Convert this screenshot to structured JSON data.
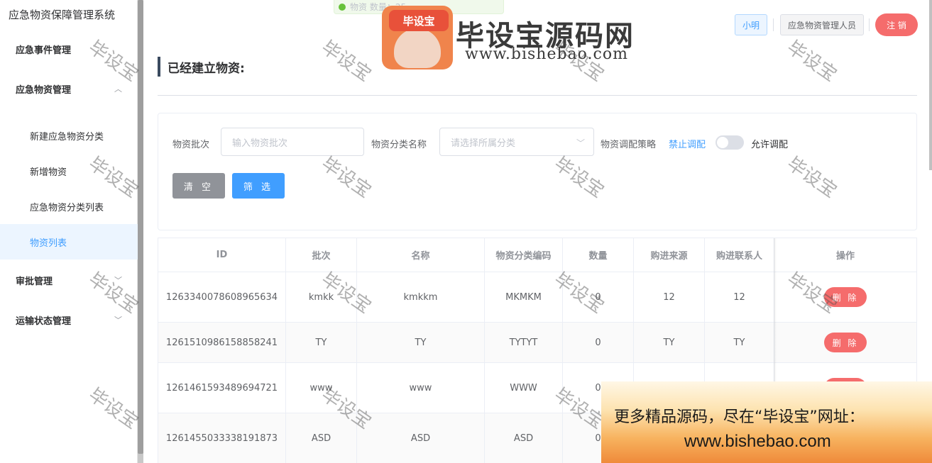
{
  "sidebar": {
    "app_title": "应急物资保障管理系统",
    "menu": [
      {
        "label": "应急事件管理"
      },
      {
        "label": "应急物资管理",
        "chevron": "^"
      },
      {
        "label": "审批管理",
        "chevron": "⌄"
      },
      {
        "label": "运输状态管理",
        "chevron": "⌄"
      }
    ],
    "submenu": [
      {
        "label": "新建应急物资分类"
      },
      {
        "label": "新增物资"
      },
      {
        "label": "应急物资分类列表"
      },
      {
        "label": "物资列表",
        "active": true
      }
    ]
  },
  "topbar": {
    "user": "小明",
    "role": "应急物资管理人员",
    "logout": "注 销",
    "toast": "物资 数量：25"
  },
  "page": {
    "title": "已经建立物资:"
  },
  "filter": {
    "batch_label": "物资批次",
    "batch_placeholder": "输入物资批次",
    "category_label": "物资分类名称",
    "category_placeholder": "请选择所属分类",
    "strategy_label": "物资调配策略",
    "switch_off_label": "禁止调配",
    "switch_on_label": "允许调配",
    "switch_value": false,
    "clear_button": "清 空",
    "filter_button": "筛 选"
  },
  "table": {
    "headers": [
      "ID",
      "批次",
      "名称",
      "物资分类编码",
      "数量",
      "购进来源",
      "购进联系人",
      "操作"
    ],
    "delete_label": "删 除",
    "rows": [
      [
        "1263340078608965634",
        "kmkk",
        "kmkkm",
        "MKMKM",
        "0",
        "12",
        "12"
      ],
      [
        "1261510986158858241",
        "TY",
        "TY",
        "TYTYT",
        "0",
        "TY",
        "TY"
      ],
      [
        "1261461593489694721",
        "www",
        "www",
        "WWW",
        "0",
        "",
        ""
      ],
      [
        "1261455033338191873",
        "ASD",
        "ASD",
        "ASD",
        "0",
        "",
        ""
      ]
    ]
  },
  "watermark": {
    "text": "毕设宝",
    "logo_tag": "毕设宝",
    "logo_title": "毕设宝源码网",
    "logo_url": "www.bishebao.com",
    "promo_line1": "更多精品源码，尽在“毕设宝”网址：",
    "promo_line2": "www.bishebao.com"
  },
  "colors": {
    "primary": "#409eff",
    "danger": "#f56c6c",
    "info": "#909399",
    "sidebar_active_bg": "#ecf5ff"
  }
}
